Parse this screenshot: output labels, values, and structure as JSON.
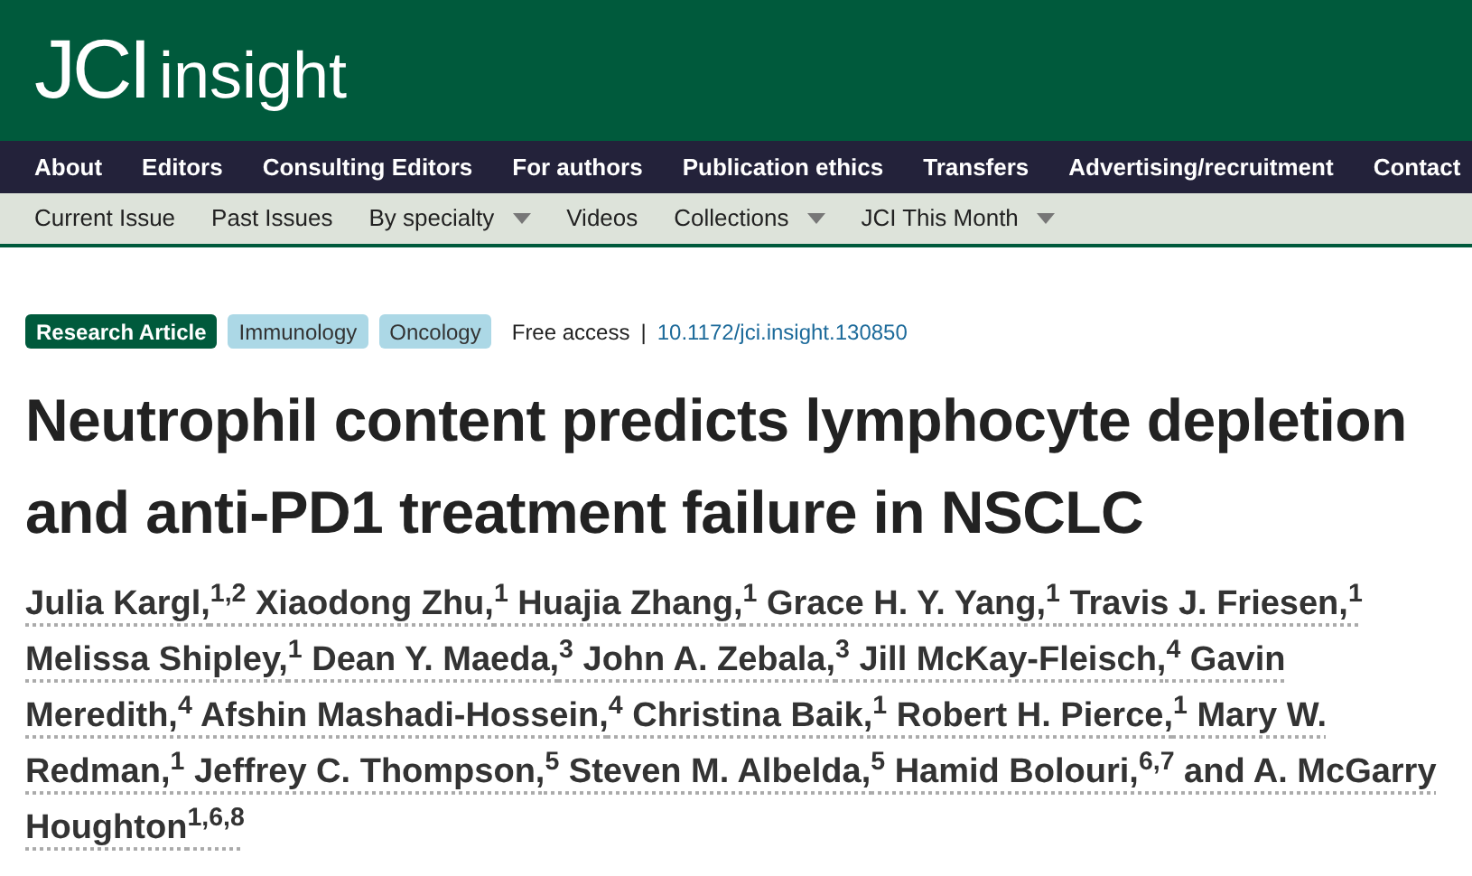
{
  "logo": {
    "primary": "JCI",
    "secondary": "insight"
  },
  "main_nav": [
    "About",
    "Editors",
    "Consulting Editors",
    "For authors",
    "Publication ethics",
    "Transfers",
    "Advertising/recruitment",
    "Contact"
  ],
  "sub_nav": [
    {
      "label": "Current Issue",
      "dropdown": false
    },
    {
      "label": "Past Issues",
      "dropdown": false
    },
    {
      "label": "By specialty",
      "dropdown": true
    },
    {
      "label": "Videos",
      "dropdown": false
    },
    {
      "label": "Collections",
      "dropdown": true
    },
    {
      "label": "JCI This Month",
      "dropdown": true
    }
  ],
  "tags": [
    {
      "label": "Research Article",
      "kind": "type"
    },
    {
      "label": "Immunology",
      "kind": "subject"
    },
    {
      "label": "Oncology",
      "kind": "subject"
    }
  ],
  "access": "Free access",
  "separator": "|",
  "doi": "10.1172/jci.insight.130850",
  "title": "Neutrophil content predicts lymphocyte depletion and anti-PD1 treatment failure in NSCLC",
  "authors": "Julia Kargl,$^{1,2}$ Xiaodong Zhu,$^{1}$ Huajia Zhang,$^{1}$ Grace H. Y. Yang,$^{1}$ Travis J. Friesen,$^{1}$ Melissa Shipley,$^{1}$ Dean Y. Maeda,$^{3}$ John A. Zebala,$^{3}$ Jill McKay-Fleisch,$^{4}$ Gavin Meredith,$^{4}$ Afshin Mashadi-Hossein,$^{4}$ Christina Baik,$^{1}$ Robert H. Pierce,$^{1}$ Mary W. Redman,$^{1}$ Jeffrey C. Thompson,$^{5}$ Steven M. Albelda,$^{5}$ Hamid Bolouri,$^{6,7}$ and A. McGarry Houghton$^{1,6,8}$"
}
